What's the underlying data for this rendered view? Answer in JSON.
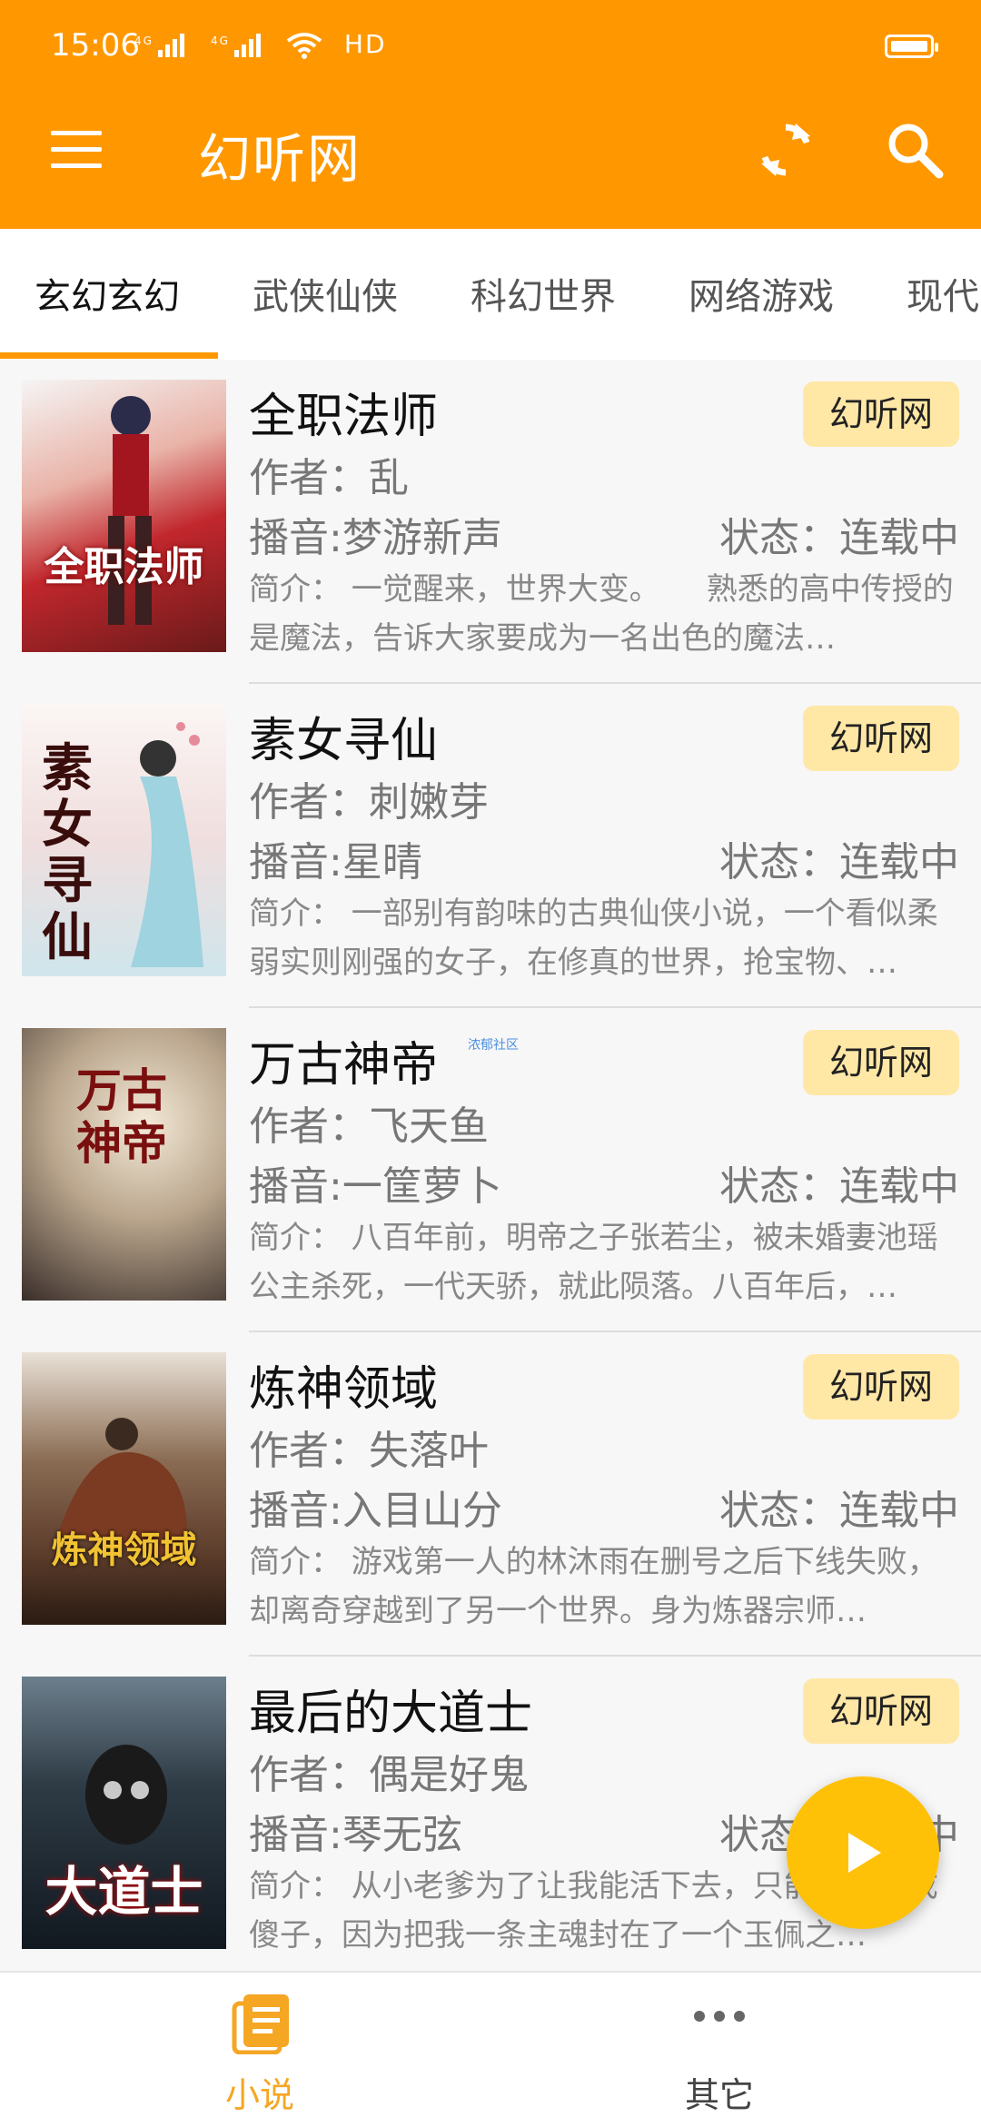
{
  "status_bar": {
    "time": "15:06",
    "network": "4G 4G",
    "hd": "HD"
  },
  "app_bar": {
    "title": "幻听网",
    "menu_icon": "menu-icon",
    "refresh_icon": "refresh-icon",
    "search_icon": "search-icon"
  },
  "tabs": [
    {
      "label": "玄幻玄幻",
      "active": true
    },
    {
      "label": "武侠仙侠"
    },
    {
      "label": "科幻世界"
    },
    {
      "label": "网络游戏"
    },
    {
      "label": "现代"
    }
  ],
  "books": [
    {
      "title": "全职法师",
      "author": "作者：乱",
      "narrator": "播音:梦游新声",
      "status": "状态：连载中",
      "intro": "简介： 一觉醒来，世界大变。　　熟悉的高中传授的是魔法，告诉大家要成为一名出色的魔法…",
      "source": "幻听网",
      "cover_text": "全职法师",
      "cover_color": "#c1272d"
    },
    {
      "title": "素女寻仙",
      "author": "作者：刺嫩芽",
      "narrator": "播音:星晴",
      "status": "状态：连载中",
      "intro": "简介： 一部别有韵味的古典仙侠小说，一个看似柔弱实则刚强的女子，在修真的世界，抢宝物、…",
      "source": "幻听网",
      "cover_text": "素女寻仙",
      "cover_color": "#f3e6e6"
    },
    {
      "title": "万古神帝",
      "author": "作者：飞天鱼",
      "narrator": "播音:一筐萝卜",
      "status": "状态：连载中",
      "intro": "简介： 八百年前，明帝之子张若尘，被未婚妻池瑶公主杀死，一代天骄，就此陨落。八百年后，…",
      "source": "幻听网",
      "cover_text": "万古神帝",
      "cover_color": "#3a2e2a",
      "watermark": "浓郁社区"
    },
    {
      "title": "炼神领域",
      "author": "作者：失落叶",
      "narrator": "播音:入目山分",
      "status": "状态：连载中",
      "intro": "简介： 游戏第一人的林沐雨在删号之后下线失败，却离奇穿越到了另一个世界。身为炼器宗师…",
      "source": "幻听网",
      "cover_text": "炼神领域",
      "cover_color": "#5b3b2a"
    },
    {
      "title": "最后的大道士",
      "author": "作者：偶是好鬼",
      "narrator": "播音:琴无弦",
      "status": "状态：连载中",
      "intro": "简介： 从小老爹为了让我能活下去，只能把我变成傻子，因为把我一条主魂封在了一个玉佩之…",
      "source": "幻听网",
      "cover_text": "大道士",
      "cover_color": "#1f2a33"
    }
  ],
  "bottom_nav": [
    {
      "label": "小说",
      "active": true,
      "icon": "book-list-icon"
    },
    {
      "label": "其它",
      "active": false,
      "icon": "more-dots-icon"
    }
  ],
  "colors": {
    "primary": "#ff9800",
    "accent": "#ffc107",
    "badge_bg": "#ffe7a6"
  }
}
